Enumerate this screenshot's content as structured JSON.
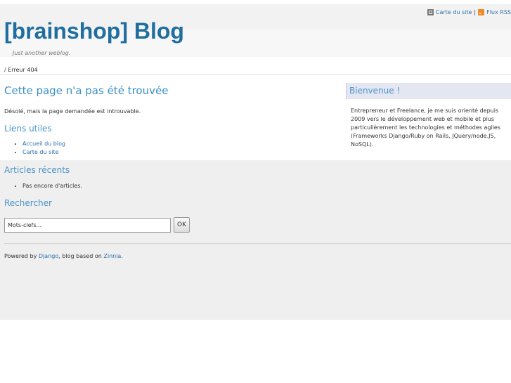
{
  "top_links": {
    "sitemap": "Carte du site",
    "separator": "|",
    "rss": "Flux RSS"
  },
  "site": {
    "title": "[brainshop] Blog",
    "tagline": "Just another weblog."
  },
  "breadcrumb": "/ Erreur 404",
  "main": {
    "heading": "Cette page n'a pas été trouvée",
    "message": "Désolé, mais la page demandée est introuvable.",
    "useful_links": {
      "heading": "Liens utiles",
      "items": [
        {
          "label": "Accueil du blog"
        },
        {
          "label": "Carte du site"
        }
      ]
    },
    "recent_articles": {
      "heading": "Articles récents",
      "items": [
        {
          "label": "Pas encore d'articles."
        }
      ]
    },
    "search": {
      "heading": "Rechercher",
      "placeholder": "Mots-clefs...",
      "button": "OK"
    }
  },
  "footer": {
    "prefix": "Powered by ",
    "django": "Django",
    "middle": ", blog based on ",
    "zinnia": "Zinnia",
    "suffix": "."
  },
  "sidebar": {
    "heading": "Bienvenue !",
    "text": "Entrepreneur et Freelance, je me suis orienté depuis 2009 vers le développement web et mobile et plus particulièrement les technologies et méthodes agiles (Frameworks Django/Ruby on Rails, JQuery/node.JS, NoSQL)."
  },
  "colors": {
    "title": "#1f6e9f",
    "heading": "#3a8fc8",
    "link": "#2a6fa8",
    "sidebar_bg": "#e4e6f2",
    "gray_band": "#efefef"
  },
  "icons": {
    "sitemap": "sitemap-icon",
    "rss": "rss-icon"
  }
}
